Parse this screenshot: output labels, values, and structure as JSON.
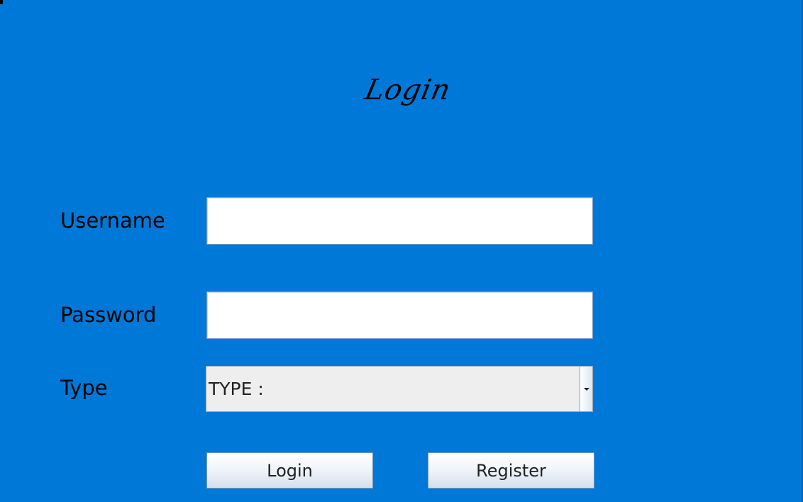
{
  "window": {
    "title": "Login"
  },
  "form": {
    "username_label": "Username",
    "username_value": "",
    "password_label": "Password",
    "password_value": "",
    "type_label": "Type",
    "type_selected": "TYPE :"
  },
  "buttons": {
    "login_label": "Login",
    "register_label": "Register"
  },
  "icons": {
    "dropdown": "chevron-down-icon"
  },
  "colors": {
    "background": "#0078d7",
    "input_background": "#ffffff",
    "combo_background": "#eeeeee"
  }
}
